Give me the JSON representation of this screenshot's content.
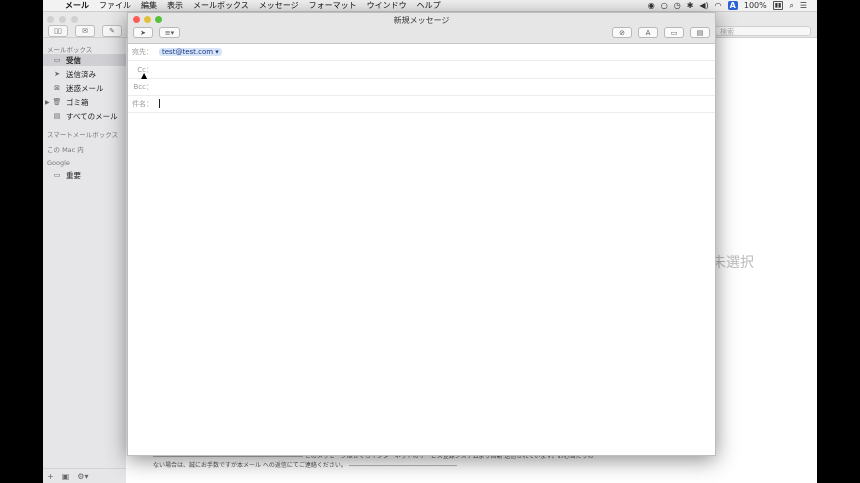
{
  "menubar": {
    "apple": "",
    "items": [
      "メール",
      "ファイル",
      "編集",
      "表示",
      "メールボックス",
      "メッセージ",
      "フォーマット",
      "ウインドウ",
      "ヘルプ"
    ],
    "battery": "100%"
  },
  "background": {
    "search_placeholder": "検索",
    "sidebar": {
      "section_mailboxes": "メールボックス",
      "items": [
        {
          "label": "受信",
          "icon": "inbox-icon"
        },
        {
          "label": "送信済み",
          "icon": "paper-plane-icon"
        },
        {
          "label": "迷惑メール",
          "icon": "junk-icon"
        },
        {
          "label": "ゴミ箱",
          "icon": "trash-icon"
        },
        {
          "label": "すべてのメール",
          "icon": "archive-icon"
        }
      ],
      "section_smart": "スマートメールボックス",
      "section_mac": "この Mac 内",
      "section_google": "Google",
      "google_items": [
        {
          "label": "重要",
          "icon": "folder-icon"
        }
      ]
    },
    "no_selection": "ジ未選択",
    "footer_text": "――――――――――――――――――――――――― このメッセージはさくらインターネットのサービス登録システムより自動 送信されています。お心当たりのない場合は、誠にお手数ですが本メール への返信にてご連絡ください。 ――――――――――――――――――"
  },
  "compose": {
    "title": "新規メッセージ",
    "to_label": "宛先：",
    "to_value": "test@test.com",
    "cc_label": "Cc：",
    "bcc_label": "Bcc：",
    "subject_label": "件名：",
    "subject_value": ""
  }
}
